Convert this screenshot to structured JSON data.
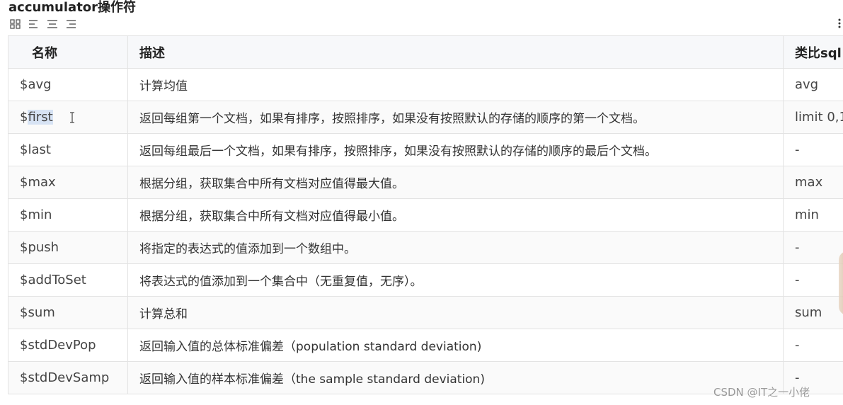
{
  "title": "accumulator操作符",
  "toolbar": {
    "icons": [
      "grid-icon",
      "align-left-icon",
      "align-center-icon",
      "align-right-icon",
      "more-icon"
    ]
  },
  "table": {
    "headers": [
      "名称",
      "描述",
      "类比sql"
    ],
    "rows": [
      {
        "name": "$avg",
        "desc": "计算均值",
        "sql": "avg"
      },
      {
        "name_prefix": "$",
        "name_selected": "first",
        "desc": "返回每组第一个文档，如果有排序，按照排序，如果没有按照默认的存储的顺序的第一个文档。",
        "sql": "limit 0,1"
      },
      {
        "name": "$last",
        "desc": "返回每组最后一个文档，如果有排序，按照排序，如果没有按照默认的存储的顺序的最后个文档。",
        "sql": "-"
      },
      {
        "name": "$max",
        "desc": "根据分组，获取集合中所有文档对应值得最大值。",
        "sql": "max"
      },
      {
        "name": "$min",
        "desc": "根据分组，获取集合中所有文档对应值得最小值。",
        "sql": "min"
      },
      {
        "name": "$push",
        "desc": "将指定的表达式的值添加到一个数组中。",
        "sql": "-"
      },
      {
        "name": "$addToSet",
        "desc": "将表达式的值添加到一个集合中（无重复值，无序）。",
        "sql": "-"
      },
      {
        "name": "$sum",
        "desc": "计算总和",
        "sql": "sum"
      },
      {
        "name": "$stdDevPop",
        "desc": "返回输入值的总体标准偏差（population standard deviation)",
        "sql": "-"
      },
      {
        "name": "$stdDevSamp",
        "desc": "返回输入值的样本标准偏差（the sample standard deviation)",
        "sql": "-"
      }
    ]
  },
  "watermark": "CSDN @IT之一小佬"
}
